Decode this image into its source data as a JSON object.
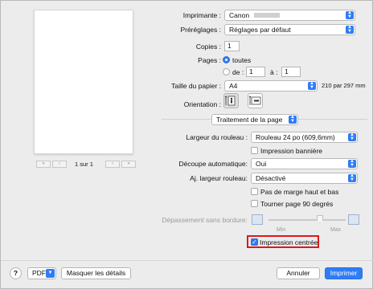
{
  "preview": {
    "page_indicator": "1 sur 1"
  },
  "printer": {
    "label": "Imprimante :",
    "value": "Canon"
  },
  "presets": {
    "label": "Préréglages :",
    "value": "Réglages par défaut"
  },
  "copies": {
    "label": "Copies :",
    "value": "1"
  },
  "pages": {
    "label": "Pages :",
    "all_label": "toutes",
    "from_label": "de :",
    "from_value": "1",
    "to_label": "à :",
    "to_value": "1"
  },
  "paper_size": {
    "label": "Taille du papier :",
    "value": "A4",
    "dimensions": "210 par 297 mm"
  },
  "orientation": {
    "label": "Orientation :"
  },
  "section": {
    "value": "Traitement de la page"
  },
  "roll_width": {
    "label": "Largeur du rouleau :",
    "value": "Rouleau 24 po (609,6mm)"
  },
  "banner_print": {
    "label": "Impression bannière",
    "checked": false
  },
  "auto_cut": {
    "label": "Découpe automatique:",
    "value": "Oui"
  },
  "roll_fit": {
    "label": "Aj. largeur rouleau:",
    "value": "Désactivé"
  },
  "no_margin": {
    "label": "Pas de marge haut et bas",
    "checked": false
  },
  "rotate": {
    "label": "Tourner page 90 degrés",
    "checked": false
  },
  "borderless": {
    "label": "Dépassement sans bordure:",
    "min_label": "Min",
    "max_label": "Max"
  },
  "centered": {
    "label": "Impression centrée",
    "checked": true,
    "check_glyph": "✓"
  },
  "footer": {
    "help": "?",
    "pdf": "PDF",
    "hide_details": "Masquer les détails",
    "cancel": "Annuler",
    "print": "Imprimer"
  },
  "colors": {
    "accent": "#2f7cf6",
    "highlight_box": "#e0161d"
  }
}
